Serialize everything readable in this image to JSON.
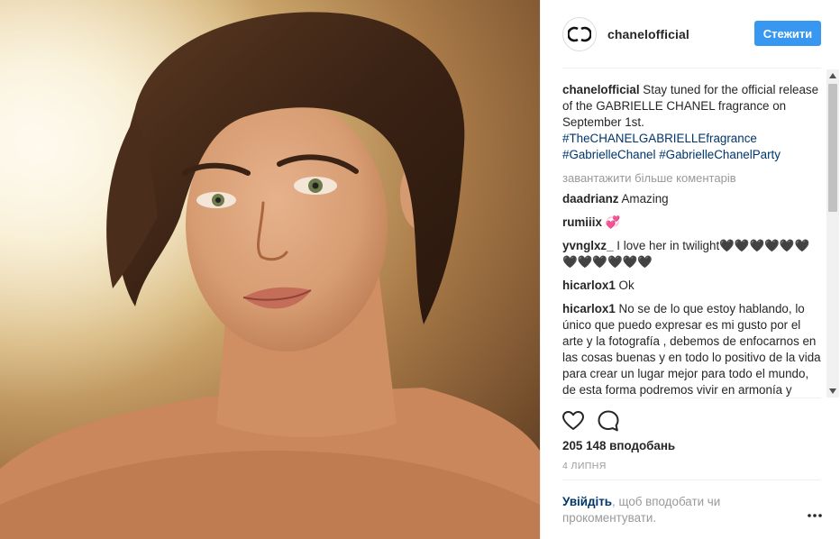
{
  "account": {
    "username": "chanelofficial",
    "follow_label": "Стежити"
  },
  "caption": {
    "username": "chanelofficial",
    "text": " Stay tuned for the official release of the GABRIELLE CHANEL fragrance on September 1st. ",
    "hashtags": [
      "#TheCHANELGABRIELLEfragrance",
      "#GabrielleChanel",
      "#GabrielleChanelParty"
    ]
  },
  "load_more_label": "завантажити більше коментарів",
  "comments": [
    {
      "username": "daadrianz",
      "text": " Amazing"
    },
    {
      "username": "rumiiix",
      "text": " 💞"
    },
    {
      "username": "yvnglxz_",
      "text": " I love her in twilight🖤🖤🖤🖤🖤🖤🖤🖤🖤🖤🖤🖤"
    },
    {
      "username": "hicarlox1",
      "text": " Ok"
    },
    {
      "username": "hicarlox1",
      "text": " No se de lo que estoy hablando, lo único que puedo expresar es mi gusto por el arte y la fotografía , debemos de enfocarnos en las cosas buenas y en todo lo positivo de la vida para crear un lugar mejor para todo el mundo, de esta forma podremos vivir en armonía y acabar con"
    }
  ],
  "likes_label": "205 148 вподобань",
  "date_label": "4 ЛИПНЯ",
  "login_prompt": {
    "link": "Увійдіть",
    "text": ", щоб вподобати чи прокоментувати."
  },
  "icons": {
    "avatar": "chanel-logo",
    "like": "heart-icon",
    "comment": "comment-bubble-icon",
    "more": "more-options-icon"
  },
  "colors": {
    "accent": "#3897f0",
    "link": "#003569",
    "muted": "#999999",
    "text": "#262626"
  }
}
